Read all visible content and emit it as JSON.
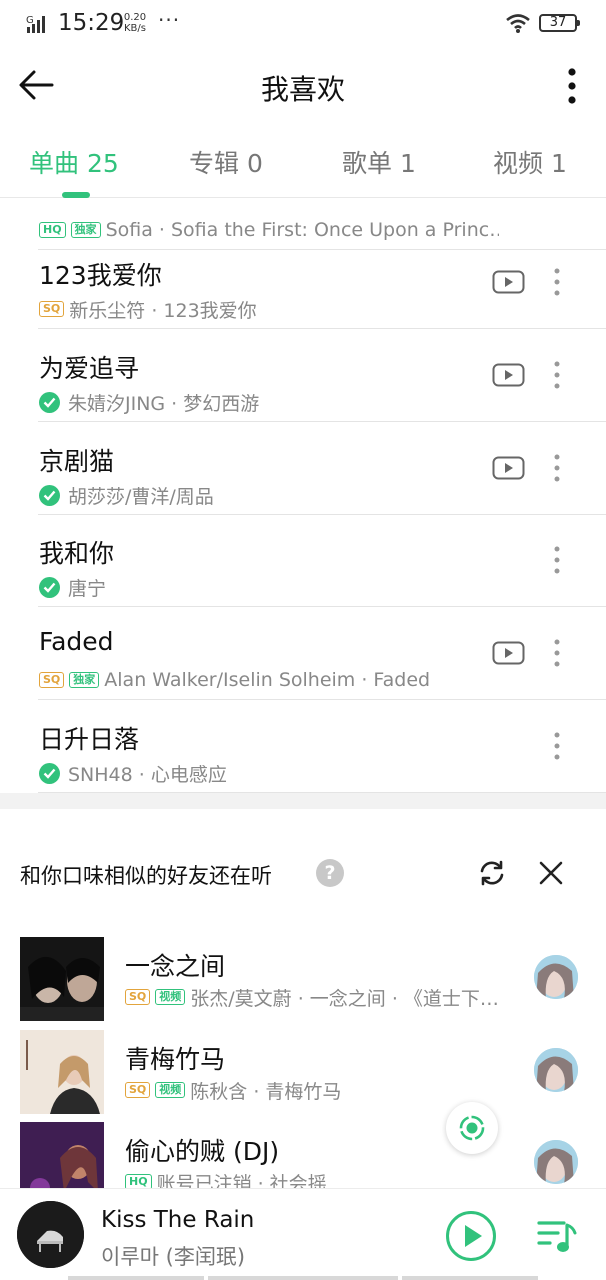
{
  "status_bar": {
    "network": "G",
    "time": "15:29",
    "speed_value": "0.20",
    "speed_unit": "KB/s",
    "more": "···",
    "battery": "37"
  },
  "header": {
    "title": "我喜欢"
  },
  "tabs": [
    {
      "label": "单曲 25",
      "active": true
    },
    {
      "label": "专辑 0",
      "active": false
    },
    {
      "label": "歌单 1",
      "active": false
    },
    {
      "label": "视频 1",
      "active": false
    }
  ],
  "songs": [
    {
      "name": "",
      "badges": [
        "HQ",
        "独家"
      ],
      "meta": "Sofia · Sofia the First: Once Upon a Princ…",
      "mv": false
    },
    {
      "name": "123我爱你",
      "badges": [
        "SQ"
      ],
      "meta": "新乐尘符 · 123我爱你",
      "mv": true
    },
    {
      "name": "为爱追寻",
      "badges": [
        "check"
      ],
      "meta": "朱婧汐JING · 梦幻西游",
      "mv": true
    },
    {
      "name": "京剧猫",
      "badges": [
        "check"
      ],
      "meta": "胡莎莎/曹洋/周品",
      "mv": true
    },
    {
      "name": "我和你",
      "badges": [
        "check"
      ],
      "meta": "唐宁",
      "mv": false
    },
    {
      "name": "Faded",
      "badges": [
        "SQ",
        "独家"
      ],
      "meta": "Alan Walker/Iselin Solheim · Faded",
      "mv": true
    },
    {
      "name": "日升日落",
      "badges": [
        "check"
      ],
      "meta": "SNH48 · 心电感应",
      "mv": false
    }
  ],
  "recommend": {
    "title": "和你口味相似的好友还在听",
    "help": "?",
    "items": [
      {
        "name": "一念之间",
        "badges": [
          "SQ",
          "视频"
        ],
        "meta": "张杰/莫文蔚 · 一念之间 · 《道士下…"
      },
      {
        "name": "青梅竹马",
        "badges": [
          "SQ",
          "视频"
        ],
        "meta": "陈秋含 · 青梅竹马"
      },
      {
        "name": "偷心的贼 (DJ)",
        "badges": [
          "HQ"
        ],
        "meta": "账号已注销 · 社会摇"
      }
    ]
  },
  "player": {
    "title": "Kiss The Rain",
    "artist": "이루마 (李闰珉)"
  },
  "colors": {
    "accent": "#31c27c",
    "sq_gold": "#e2a43c"
  }
}
